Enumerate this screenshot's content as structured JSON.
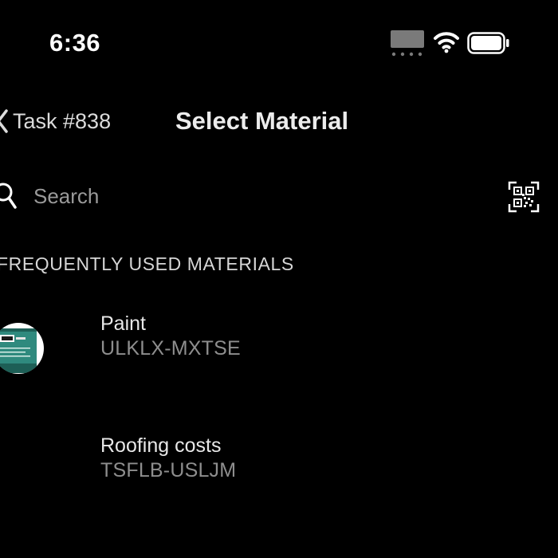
{
  "status_bar": {
    "time": "6:36",
    "icons": [
      "cellular-signal-icon",
      "wifi-icon",
      "battery-icon"
    ]
  },
  "nav": {
    "back_label": "Task #838",
    "title": "Select Material"
  },
  "search": {
    "placeholder": "Search",
    "value": ""
  },
  "section": {
    "header": "FREQUENTLY USED MATERIALS"
  },
  "materials": [
    {
      "name": "Paint",
      "code": "ULKLX-MXTSE",
      "thumbnail": "paint-can-icon"
    },
    {
      "name": "Roofing costs",
      "code": "TSFLB-USLJM",
      "thumbnail": ""
    }
  ],
  "colors": {
    "background": "#000000",
    "text_primary": "#e8e8e8",
    "text_secondary": "#8e8e8e",
    "placeholder": "#9a9a9a",
    "paint_can": "#2f8a7e"
  }
}
